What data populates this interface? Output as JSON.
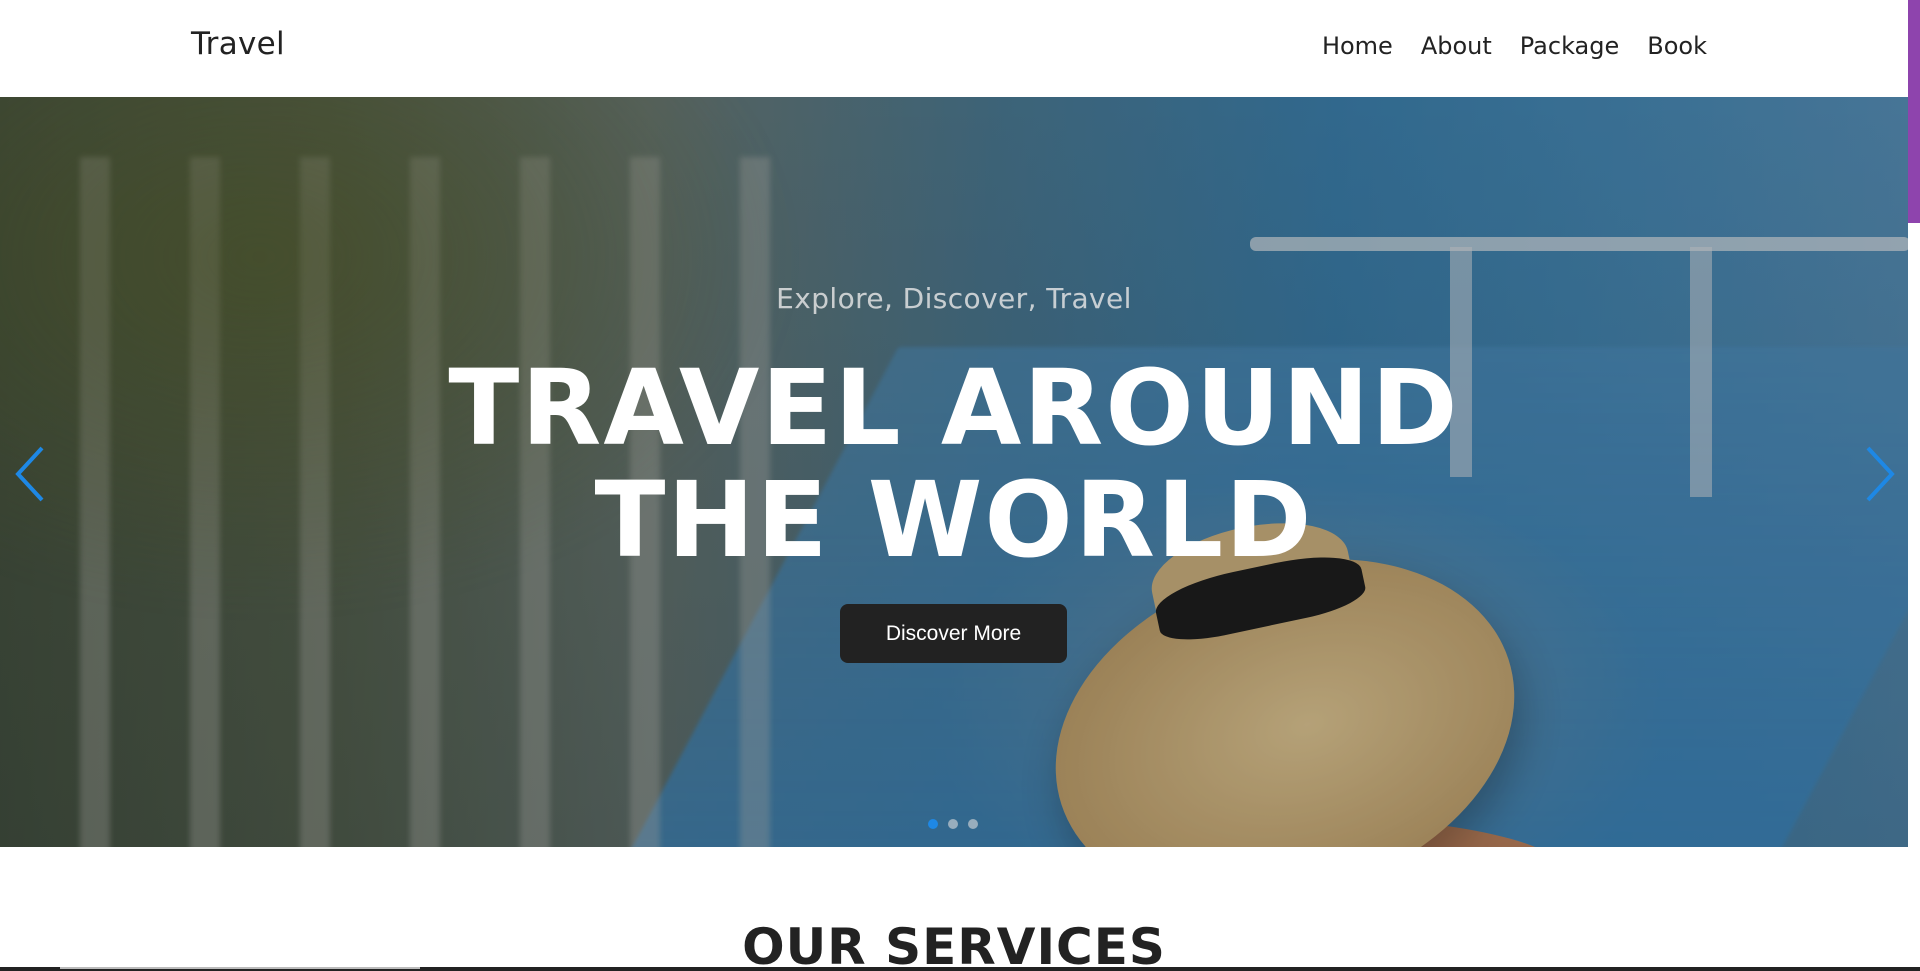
{
  "navbar": {
    "brand": "Travel",
    "links": [
      "Home",
      "About",
      "Package",
      "Book"
    ]
  },
  "hero": {
    "subtitle": "Explore, Discover, Travel",
    "title_line1": "TRAVEL AROUND",
    "title_line2": "THE WORLD",
    "button_label": "Discover More",
    "prev_icon": "chevron-left-icon",
    "next_icon": "chevron-right-icon",
    "slides_total": 3,
    "active_slide": 1
  },
  "services": {
    "heading": "OUR SERVICES"
  },
  "colors": {
    "accent_blue": "#1e88e5",
    "button_dark": "#222222",
    "scrollbar_purple": "#8e44ad"
  }
}
